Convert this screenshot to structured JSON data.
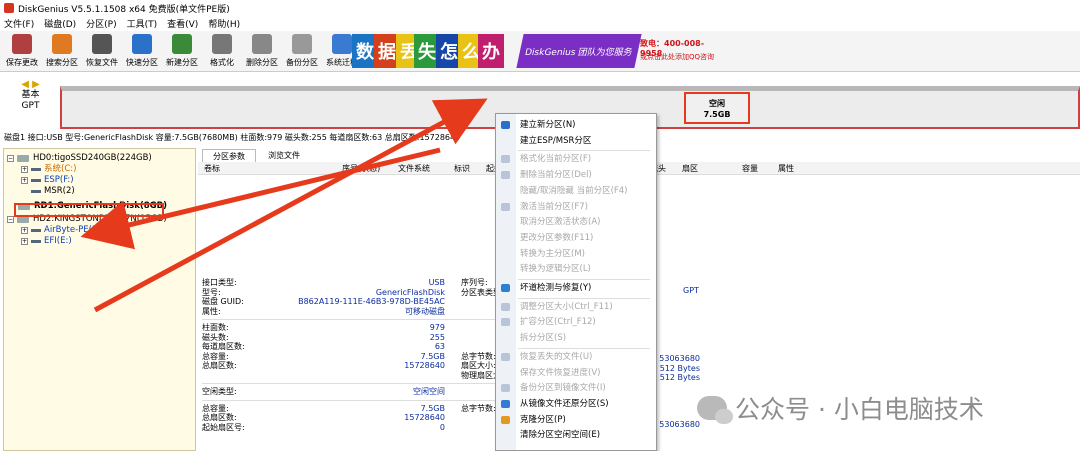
{
  "window": {
    "title": "DiskGenius V5.5.1.1508 x64 免费版(单文件PE版)"
  },
  "menu": [
    "文件(F)",
    "磁盘(D)",
    "分区(P)",
    "工具(T)",
    "查看(V)",
    "帮助(H)"
  ],
  "toolbar": [
    {
      "label": "保存更改",
      "icon": "save-icon",
      "color": "#b04040"
    },
    {
      "label": "搜索分区",
      "icon": "search-icon",
      "color": "#e07a20"
    },
    {
      "label": "恢复文件",
      "icon": "recover-icon",
      "color": "#555555"
    },
    {
      "label": "快速分区",
      "icon": "quick-partition-icon",
      "color": "#2a72c9"
    },
    {
      "label": "新建分区",
      "icon": "new-partition-icon",
      "color": "#3a8a3a"
    },
    {
      "label": "格式化",
      "icon": "format-icon",
      "color": "#777777"
    },
    {
      "label": "删除分区",
      "icon": "delete-icon",
      "color": "#888888"
    },
    {
      "label": "备份分区",
      "icon": "backup-icon",
      "color": "#999999"
    },
    {
      "label": "系统迁移",
      "icon": "migrate-icon",
      "color": "#3a7ad0"
    }
  ],
  "banner": {
    "tiles": [
      {
        "char": "数",
        "bg": "#1b73c4"
      },
      {
        "char": "据",
        "bg": "#d43f1c"
      },
      {
        "char": "丢",
        "bg": "#e8c215"
      },
      {
        "char": "失",
        "bg": "#2a9a3c"
      },
      {
        "char": "怎",
        "bg": "#1546a8"
      },
      {
        "char": "么",
        "bg": "#e8c215"
      },
      {
        "char": "办",
        "bg": "#c01f6e"
      }
    ],
    "slogan": "DiskGenius 团队为您服务",
    "phone": "致电：400-008-9958",
    "qq": "或点击此处添加QQ咨询"
  },
  "diskmap": {
    "type_label": "基本",
    "scheme": "GPT",
    "free_label": "空闲",
    "free_size": "7.5GB"
  },
  "disk_info": "磁盘1 接口:USB  型号:GenericFlashDisk  容量:7.5GB(7680MB)  柱面数:979  磁头数:255  每道扇区数:63  总扇区数:15728640",
  "tree": {
    "hd0": "HD0:tigoSSD240GB(224GB)",
    "hd0_parts": [
      "系统(C:)",
      "ESP(F:)",
      "MSR(2)"
    ],
    "rd1": "RD1:GenericFlashDisk(8GB)",
    "hd2": "HD2:KINGSTONDTS-C7N(15GB)",
    "hd2_parts": [
      "AirByte-PE(D:)",
      "EFI(E:)"
    ]
  },
  "tabs": [
    "分区参数",
    "浏览文件"
  ],
  "columns": [
    "卷标",
    "序号(状态)",
    "文件系统",
    "标识",
    "起始柱面",
    "磁头",
    "扇区",
    "终止柱面",
    "磁头",
    "扇区",
    "容量",
    "属性"
  ],
  "details": {
    "r1": [
      {
        "k": "接口类型:",
        "v": "USB",
        "k2": "序列号:"
      },
      {
        "k": "型号:",
        "v": "GenericFlashDisk",
        "k2": "分区表类型:"
      },
      {
        "k": "磁盘 GUID:",
        "v": "B862A119-111E-46B3-978D-BE45AC",
        "k2": ""
      },
      {
        "k": "属性:",
        "v": "可移动磁盘",
        "k2": ""
      }
    ],
    "r2": [
      {
        "k": "柱面数:",
        "v": "979",
        "k2": ""
      },
      {
        "k": "磁头数:",
        "v": "255",
        "k2": ""
      },
      {
        "k": "每道扇区数:",
        "v": "63",
        "k2": ""
      },
      {
        "k": "总容量:",
        "v": "7.5GB",
        "k2": "总字节数:"
      },
      {
        "k": "总扇区数:",
        "v": "15728640",
        "k2": "扇区大小:"
      },
      {
        "k": "",
        "v": "",
        "k2": "物理扇区大小:"
      }
    ],
    "r3": [
      {
        "k": "空闲类型:",
        "v": "空闲空间",
        "k2": ""
      }
    ],
    "r4": [
      {
        "k": "总容量:",
        "v": "7.5GB",
        "k2": "总字节数:"
      },
      {
        "k": "总扇区数:",
        "v": "15728640",
        "k2": ""
      },
      {
        "k": "起始扇区号:",
        "v": "0",
        "k2": ""
      }
    ],
    "gpt": "GPT",
    "right_vals": [
      "53063680",
      "512 Bytes",
      "512 Bytes"
    ],
    "right_vals2": [
      "53063680"
    ]
  },
  "context_menu": [
    {
      "label": "建立新分区(N)",
      "enabled": true,
      "icon": "new-partition-icon",
      "color": "#2a6fc9"
    },
    {
      "label": "建立ESP/MSR分区",
      "enabled": true,
      "icon": "",
      "color": ""
    },
    {
      "label": "格式化当前分区(F)",
      "enabled": false,
      "icon": "format-icon",
      "color": "#b8c4d8"
    },
    {
      "label": "删除当前分区(Del)",
      "enabled": false,
      "icon": "delete-icon",
      "color": "#b8c4d8"
    },
    {
      "label": "隐藏/取消隐藏 当前分区(F4)",
      "enabled": false,
      "icon": "",
      "color": ""
    },
    {
      "label": "激活当前分区(F7)",
      "enabled": false,
      "icon": "activate-icon",
      "color": "#b8c4d8"
    },
    {
      "label": "取消分区激活状态(A)",
      "enabled": false,
      "icon": "",
      "color": ""
    },
    {
      "label": "更改分区参数(F11)",
      "enabled": false,
      "icon": "",
      "color": ""
    },
    {
      "label": "转换为主分区(M)",
      "enabled": false,
      "icon": "",
      "color": ""
    },
    {
      "label": "转换为逻辑分区(L)",
      "enabled": false,
      "icon": "",
      "color": ""
    },
    {
      "label": "坏道检测与修复(Y)",
      "enabled": true,
      "icon": "repair-icon",
      "color": "#2b7fd9"
    },
    {
      "label": "调整分区大小(Ctrl_F11)",
      "enabled": false,
      "icon": "resize-icon",
      "color": "#b8c4d8"
    },
    {
      "label": "扩容分区(Ctrl_F12)",
      "enabled": false,
      "icon": "extend-icon",
      "color": "#b8c4d8"
    },
    {
      "label": "拆分分区(S)",
      "enabled": false,
      "icon": "",
      "color": ""
    },
    {
      "label": "恢复丢失的文件(U)",
      "enabled": false,
      "icon": "recover-icon",
      "color": "#b8c4d8"
    },
    {
      "label": "保存文件恢复进度(V)",
      "enabled": false,
      "icon": "",
      "color": ""
    },
    {
      "label": "备份分区到镜像文件(I)",
      "enabled": false,
      "icon": "backup-icon",
      "color": "#b8c4d8"
    },
    {
      "label": "从镜像文件还原分区(S)",
      "enabled": true,
      "icon": "restore-icon",
      "color": "#3579d6"
    },
    {
      "label": "克隆分区(P)",
      "enabled": true,
      "icon": "clone-icon",
      "color": "#e09a20"
    },
    {
      "label": "清除分区空闲空间(E)",
      "enabled": true,
      "icon": "",
      "color": ""
    }
  ],
  "watermark": "公众号 · 小白电脑技术",
  "colors": {
    "annotation": "#e53a1c",
    "tree_bg": "#fffbe4"
  }
}
